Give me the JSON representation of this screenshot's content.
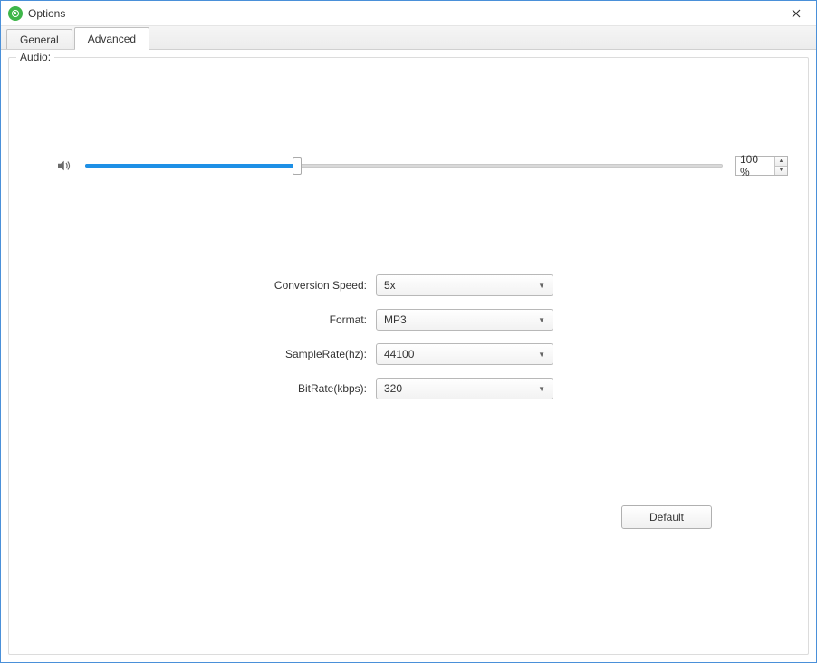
{
  "window": {
    "title": "Options"
  },
  "tabs": {
    "general": "General",
    "advanced": "Advanced"
  },
  "section": {
    "audio": "Audio:"
  },
  "volume": {
    "value": "100 %"
  },
  "fields": {
    "conversion_speed": {
      "label": "Conversion Speed:",
      "value": "5x"
    },
    "format": {
      "label": "Format:",
      "value": "MP3"
    },
    "sample_rate": {
      "label": "SampleRate(hz):",
      "value": "44100"
    },
    "bit_rate": {
      "label": "BitRate(kbps):",
      "value": "320"
    }
  },
  "buttons": {
    "default": "Default"
  }
}
